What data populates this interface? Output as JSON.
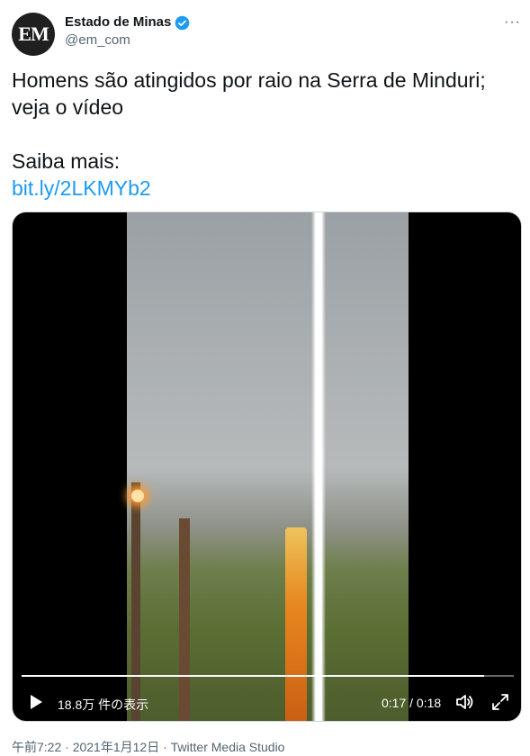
{
  "account": {
    "avatar_text": "EM",
    "display_name": "Estado de Minas",
    "handle": "@em_com",
    "verified": true,
    "more_label": "···"
  },
  "tweet": {
    "line1": "Homens são atingidos por raio na Serra de Minduri;",
    "line2": "veja o vídeo",
    "line3": "Saiba mais:",
    "link": "bit.ly/2LKMYb2"
  },
  "video": {
    "views": "18.8万 件の表示",
    "time": "0:17 / 0:18",
    "progress": 0.94,
    "icons": [
      "play-icon",
      "volume-icon",
      "fullscreen-icon"
    ]
  },
  "meta": {
    "timestamp": "午前7:22 · 2021年1月12日 · Twitter Media Studio"
  },
  "colors": {
    "link": "#1d9bf0",
    "verified": "#1d9bf0",
    "secondary_text": "#536471"
  }
}
